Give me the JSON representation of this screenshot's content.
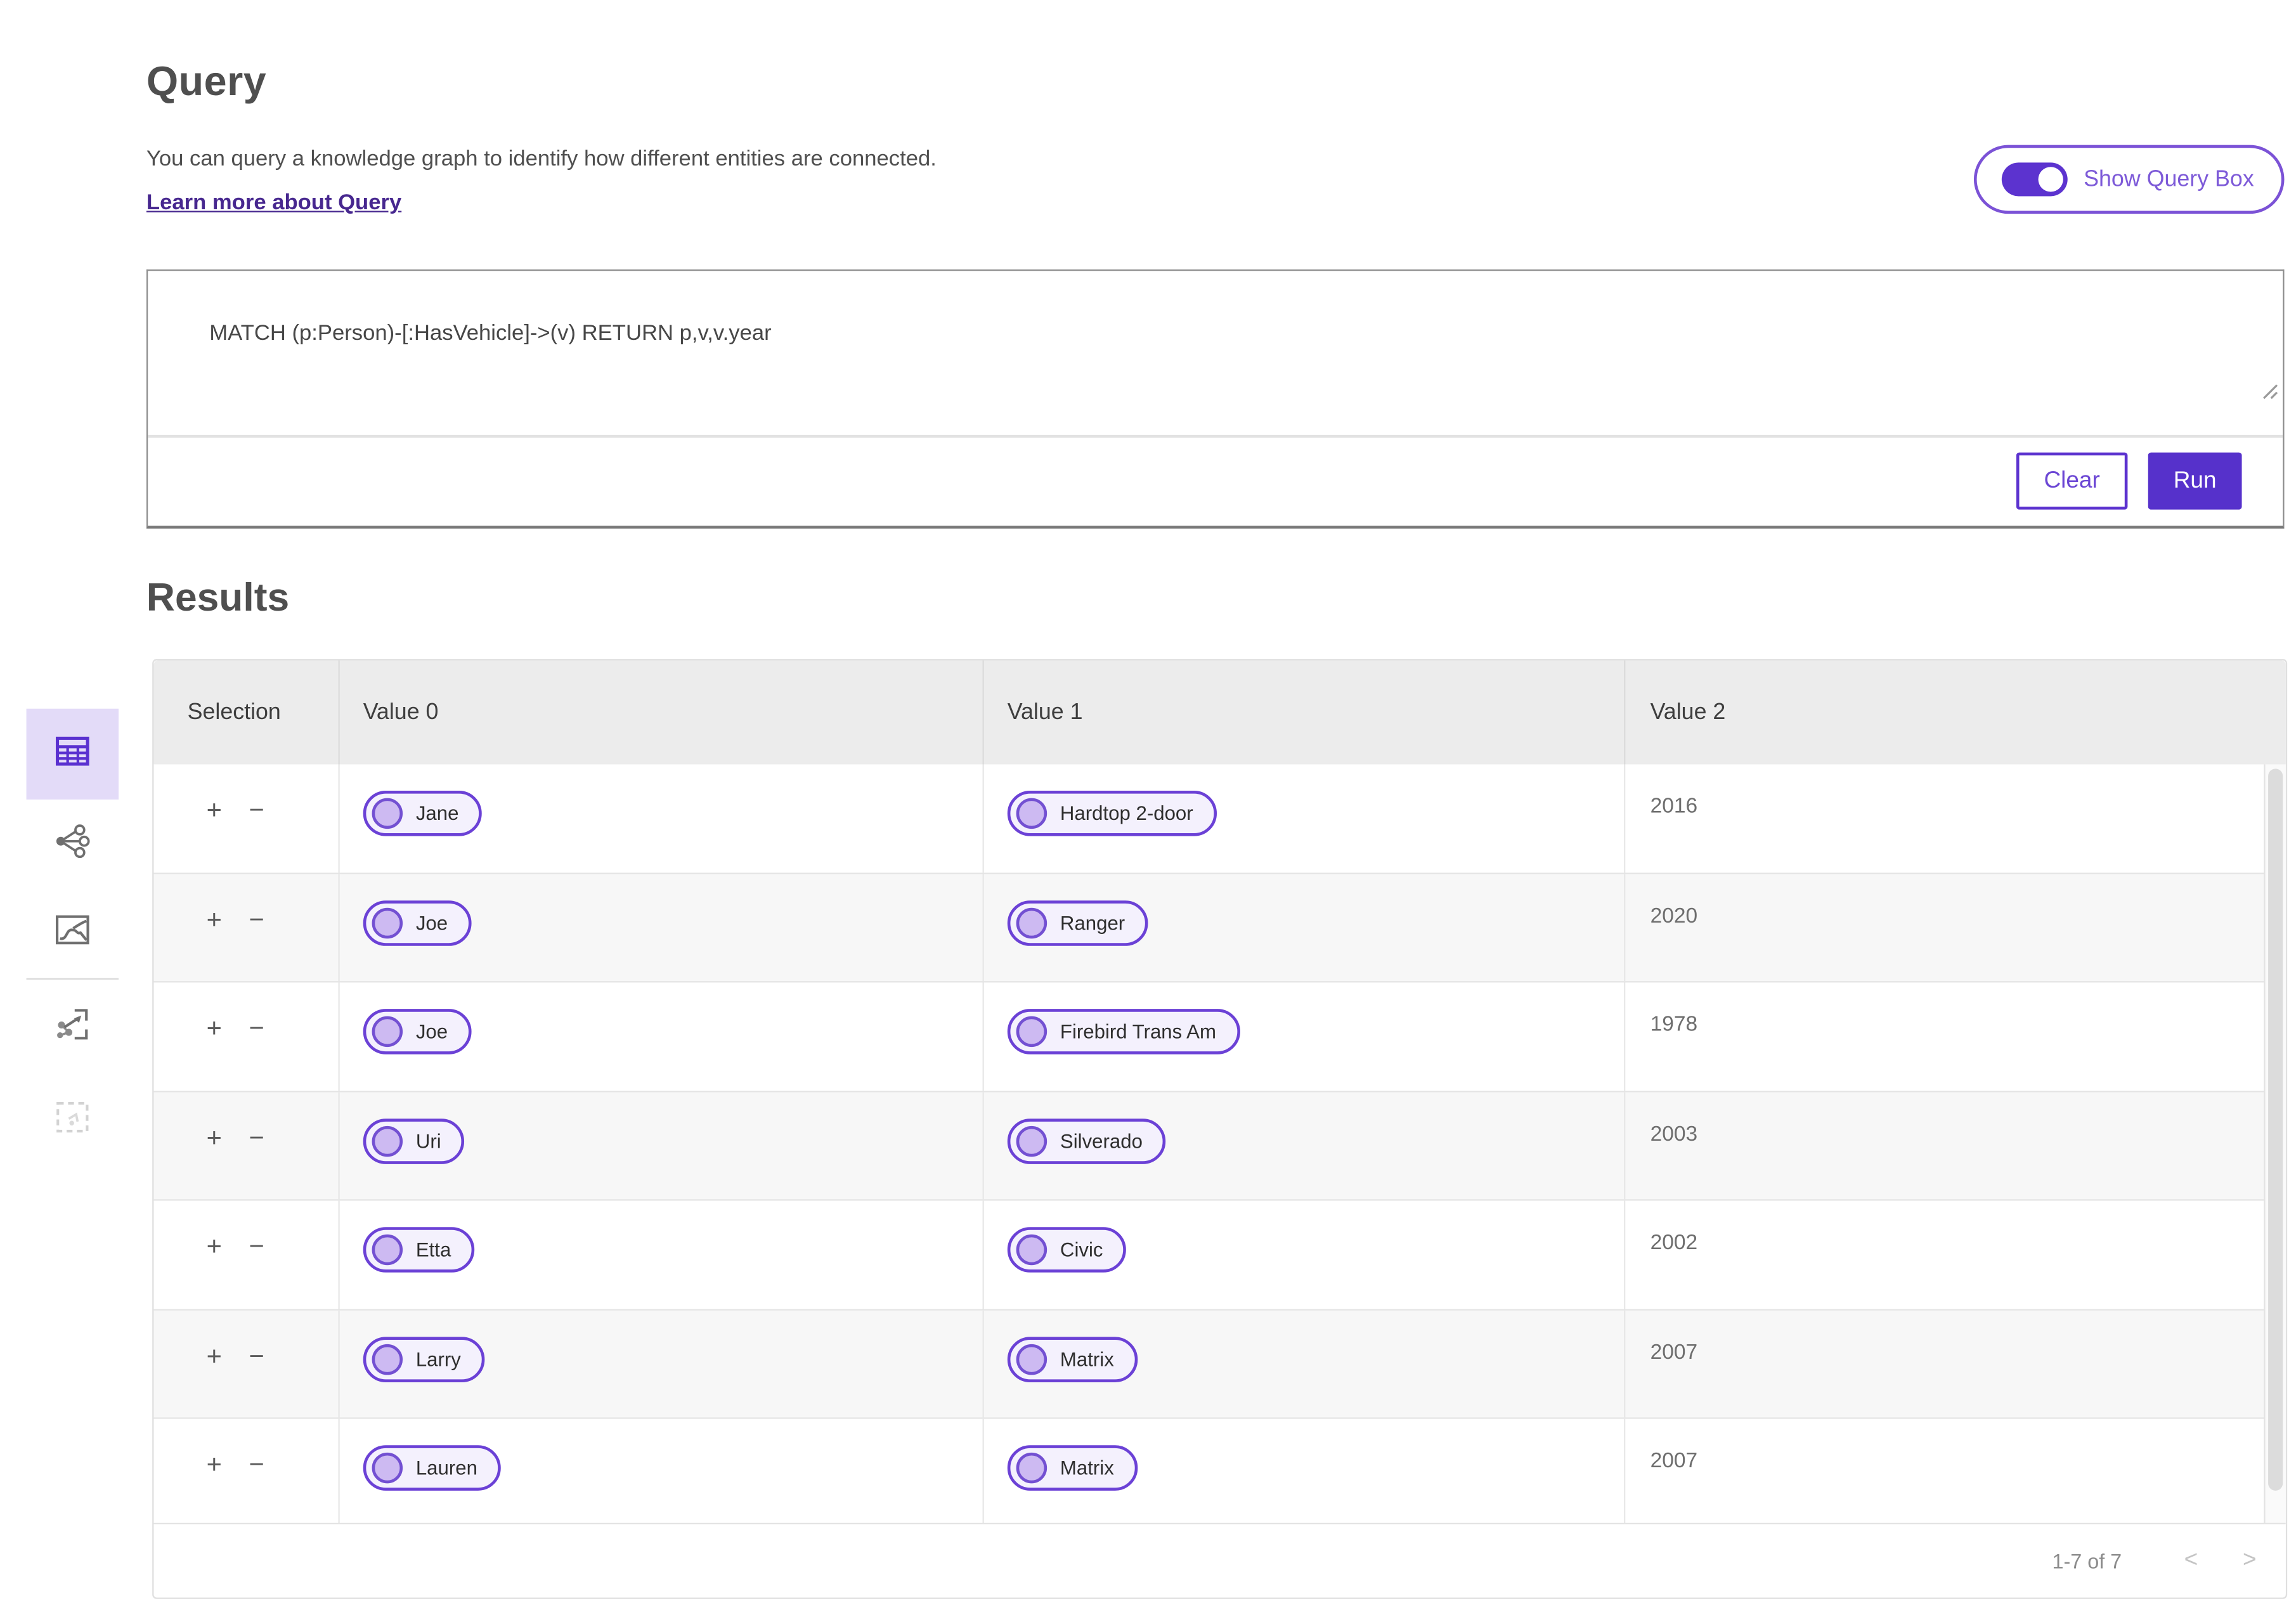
{
  "header": {
    "title": "Query",
    "description": "You can query a knowledge graph to identify how different entities are connected.",
    "learn_more": "Learn more about Query",
    "toggle_label": "Show Query Box",
    "toggle_state": "on"
  },
  "query_box": {
    "text": "MATCH (p:Person)-[:HasVehicle]->(v) RETURN p,v,v.year",
    "clear_label": "Clear",
    "run_label": "Run"
  },
  "sidebar": {
    "items": [
      {
        "name": "table-view",
        "icon": "table-icon",
        "active": true
      },
      {
        "name": "network-view",
        "icon": "network-icon",
        "active": false
      },
      {
        "name": "route-view",
        "icon": "route-icon",
        "active": false
      },
      {
        "name": "open-in-graph",
        "icon": "graph-export-icon",
        "active": false
      },
      {
        "name": "selection-tool",
        "icon": "selection-icon",
        "active": false,
        "disabled": true
      }
    ]
  },
  "results": {
    "title": "Results",
    "columns": [
      "Selection",
      "Value 0",
      "Value 1",
      "Value 2"
    ],
    "row_controls": {
      "expand": "+",
      "collapse": "−"
    },
    "rows": [
      {
        "person": "Jane",
        "vehicle": "Hardtop 2-door",
        "year": "2016"
      },
      {
        "person": "Joe",
        "vehicle": "Ranger",
        "year": "2020"
      },
      {
        "person": "Joe",
        "vehicle": "Firebird Trans Am",
        "year": "1978"
      },
      {
        "person": "Uri",
        "vehicle": "Silverado",
        "year": "2003"
      },
      {
        "person": "Etta",
        "vehicle": "Civic",
        "year": "2002"
      },
      {
        "person": "Larry",
        "vehicle": "Matrix",
        "year": "2007"
      },
      {
        "person": "Lauren",
        "vehicle": "Matrix",
        "year": "2007"
      }
    ],
    "pagination": {
      "range": "1-7 of 7",
      "prev": "<",
      "next": ">"
    }
  },
  "colors": {
    "accent": "#5c33cf",
    "accent_light": "#7d5ad8",
    "link": "#47278f",
    "chip_bg": "#f4f1fd",
    "chip_circle": "#cdbaf2",
    "active_item_bg": "#e3dbf8",
    "header_bg": "#ececec",
    "row_alt_bg": "#f7f7f7"
  }
}
